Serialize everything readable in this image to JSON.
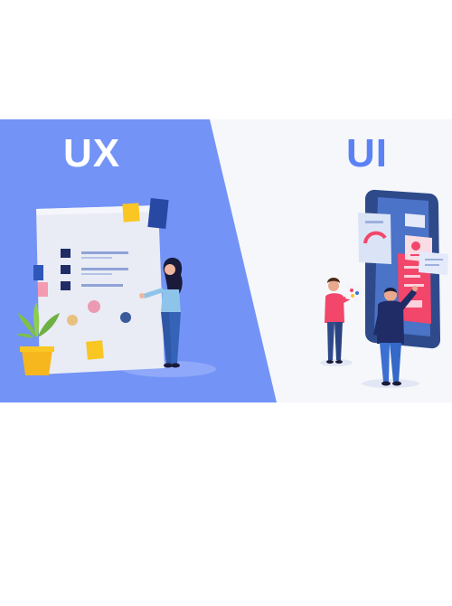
{
  "banner": {
    "left_label": "UX",
    "right_label": "UI"
  },
  "colors": {
    "ux_panel": "#7393f7",
    "ui_panel": "#f6f7fb",
    "ui_label": "#5b82f5",
    "accent_pink": "#f2466a",
    "navy": "#1f2c66",
    "yellow": "#f9c623"
  },
  "illustrations": {
    "left": [
      "document-board",
      "checklist",
      "sticky-notes",
      "plant-pot",
      "designer-woman"
    ],
    "right": [
      "phone-mockup",
      "designer-man",
      "designer-woman-with-palette"
    ]
  }
}
